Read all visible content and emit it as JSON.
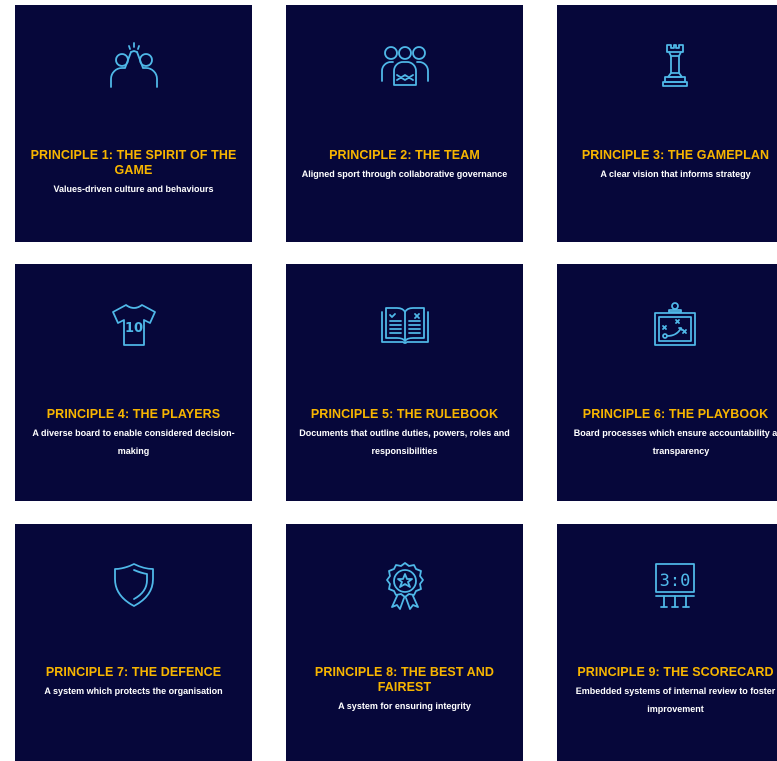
{
  "colors": {
    "card_background": "#06073a",
    "title": "#f7b500",
    "description": "#ffffff",
    "icon_stroke": "#4fb8e8"
  },
  "principles": [
    {
      "title": "PRINCIPLE 1: THE SPIRIT OF THE GAME",
      "description": "Values-driven culture and behaviours",
      "icon": "high-five-icon"
    },
    {
      "title": "PRINCIPLE 2: THE TEAM",
      "description": "Aligned sport through collaborative governance",
      "icon": "team-icon"
    },
    {
      "title": "PRINCIPLE 3: THE GAMEPLAN",
      "description": "A clear vision that informs strategy",
      "icon": "chess-rook-icon"
    },
    {
      "title": "PRINCIPLE 4: THE PLAYERS",
      "description": "A diverse board to enable considered decision-making",
      "icon": "jersey-icon"
    },
    {
      "title": "PRINCIPLE 5: THE RULEBOOK",
      "description": "Documents that outline duties, powers, roles and responsibilities",
      "icon": "open-book-icon"
    },
    {
      "title": "PRINCIPLE 6: THE PLAYBOOK",
      "description": "Board processes which ensure accountability and transparency",
      "icon": "tactics-board-icon"
    },
    {
      "title": "PRINCIPLE 7: THE DEFENCE",
      "description": "A system which protects the organisation",
      "icon": "shield-icon"
    },
    {
      "title": "PRINCIPLE 8: THE BEST AND FAIREST",
      "description": "A system for ensuring integrity",
      "icon": "award-rosette-icon"
    },
    {
      "title": "PRINCIPLE 9: THE SCORECARD",
      "description": "Embedded systems of internal review to foster improvement",
      "icon": "scoreboard-icon"
    }
  ],
  "scoreboard": {
    "score": "3:0",
    "jersey_number": "10"
  }
}
